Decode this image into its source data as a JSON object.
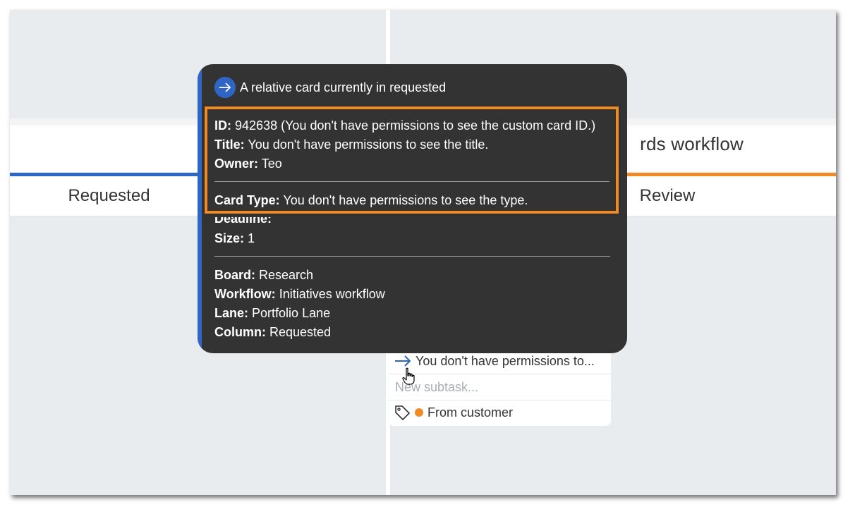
{
  "board": {
    "workflow_title": "rds workflow",
    "columns": {
      "left": "Requested",
      "right": "Review"
    }
  },
  "subtasks": {
    "item_text": "You don't have permissions to...",
    "new_placeholder": "New subtask...",
    "tag_label": "From customer"
  },
  "tooltip": {
    "header": "A relative card currently in requested",
    "id_label": "ID:",
    "id_value": "942638 (You don't have permissions to see the custom card ID.)",
    "title_label": "Title:",
    "title_value": "You don't have permissions to see the title.",
    "owner_label": "Owner:",
    "owner_value": "Teo",
    "type_label": "Card Type:",
    "type_value": "You don't have permissions to see the type.",
    "deadline_label": "Deadline:",
    "size_label": "Size:",
    "size_value": "1",
    "board_label": "Board:",
    "board_value": "Research",
    "workflow_label": "Workflow:",
    "workflow_value": "Initiatives workflow",
    "lane_label": "Lane:",
    "lane_value": "Portfolio Lane",
    "column_label": "Column:",
    "column_value": "Requested"
  },
  "colors": {
    "accent_blue": "#2f66c4",
    "accent_orange": "#f08a24",
    "tooltip_bg": "#333333",
    "board_bg": "#e9ecef"
  },
  "icons": [
    "arrow-right-icon",
    "tag-icon",
    "hand-pointer-icon"
  ]
}
